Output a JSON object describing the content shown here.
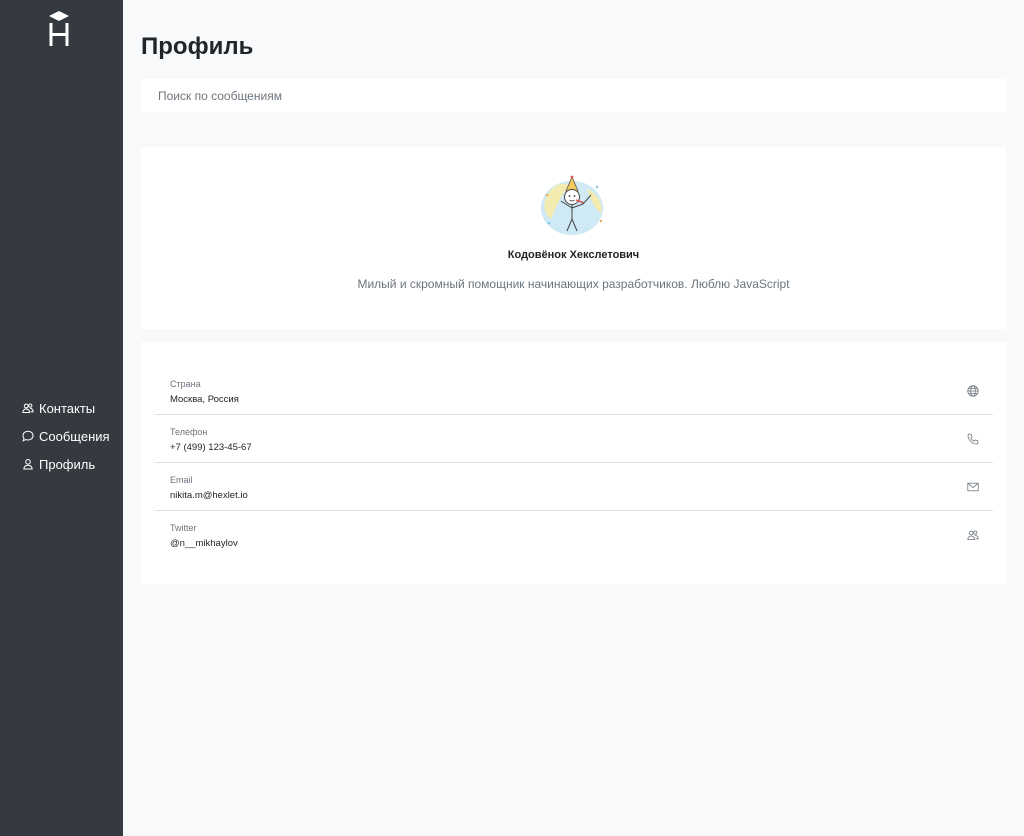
{
  "sidebar": {
    "logo_icon": "hexlet-logo-icon",
    "items": [
      {
        "label": "Контакты",
        "icon": "contacts-icon"
      },
      {
        "label": "Сообщения",
        "icon": "messages-icon"
      },
      {
        "label": "Профиль",
        "icon": "profile-icon"
      }
    ]
  },
  "main": {
    "title": "Профиль",
    "search": {
      "placeholder": "Поиск по сообщениям",
      "value": ""
    },
    "profile": {
      "avatar_icon": "avatar-image",
      "name": "Кодовёнок Хекслетович",
      "bio": "Милый и скромный помощник начинающих разработчиков. Люблю JavaScript"
    },
    "info": [
      {
        "label": "Страна",
        "value": "Москва, Россия",
        "icon": "globe-icon"
      },
      {
        "label": "Телефон",
        "value": "+7 (499) 123-45-67",
        "icon": "phone-icon"
      },
      {
        "label": "Email",
        "value": "nikita.m@hexlet.io",
        "icon": "envelope-icon"
      },
      {
        "label": "Twitter",
        "value": "@n__mikhaylov",
        "icon": "people-icon"
      }
    ]
  },
  "colors": {
    "sidebar_bg": "#343a40",
    "page_bg": "#f8f9fa",
    "card_bg": "#ffffff",
    "muted_text": "#6c757d"
  }
}
